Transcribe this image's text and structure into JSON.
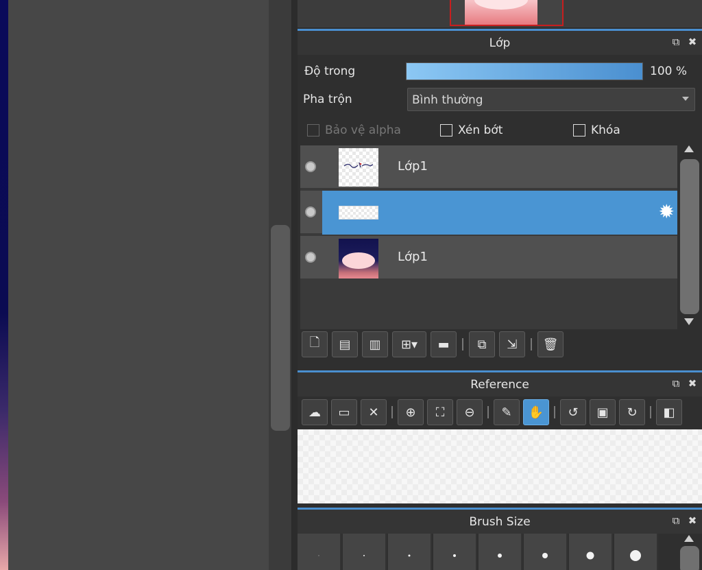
{
  "layer_panel": {
    "title": "Lớp",
    "opacity_label": "Độ trong",
    "opacity_percent": 100,
    "opacity_value": "100 %",
    "blend_label": "Pha trộn",
    "blend_value": "Bình thường",
    "checks": [
      {
        "label": "Bảo vệ alpha",
        "checked": false,
        "enabled": false
      },
      {
        "label": "Xén bớt",
        "checked": false,
        "enabled": true
      },
      {
        "label": "Khóa",
        "checked": false,
        "enabled": true
      }
    ],
    "layers": [
      {
        "name": "Lớp1",
        "visible": true,
        "selected": false
      },
      {
        "name": "",
        "visible": true,
        "selected": true
      },
      {
        "name": "Lớp1",
        "visible": true,
        "selected": false
      }
    ],
    "toolbar_icons": [
      "new-layer-icon",
      "new-8bit-layer-icon",
      "new-1bit-layer-icon",
      "add-layer-menu-icon",
      "folder-icon",
      "duplicate-icon",
      "merge-down-icon",
      "trash-icon"
    ]
  },
  "reference_panel": {
    "title": "Reference",
    "toolbar_icons": [
      "upload-icon",
      "open-folder-icon",
      "close-icon",
      "zoom-in-icon",
      "fit-icon",
      "zoom-out-icon",
      "eyedropper-icon",
      "hand-icon",
      "rotate-left-icon",
      "fullscreen-icon",
      "rotate-right-icon",
      "flip-icon"
    ],
    "active_tool": "hand-icon"
  },
  "brush_panel": {
    "title": "Brush Size"
  },
  "colors": {
    "accent": "#4a95d3",
    "panel": "#2f2f2f",
    "row": "#505050"
  }
}
